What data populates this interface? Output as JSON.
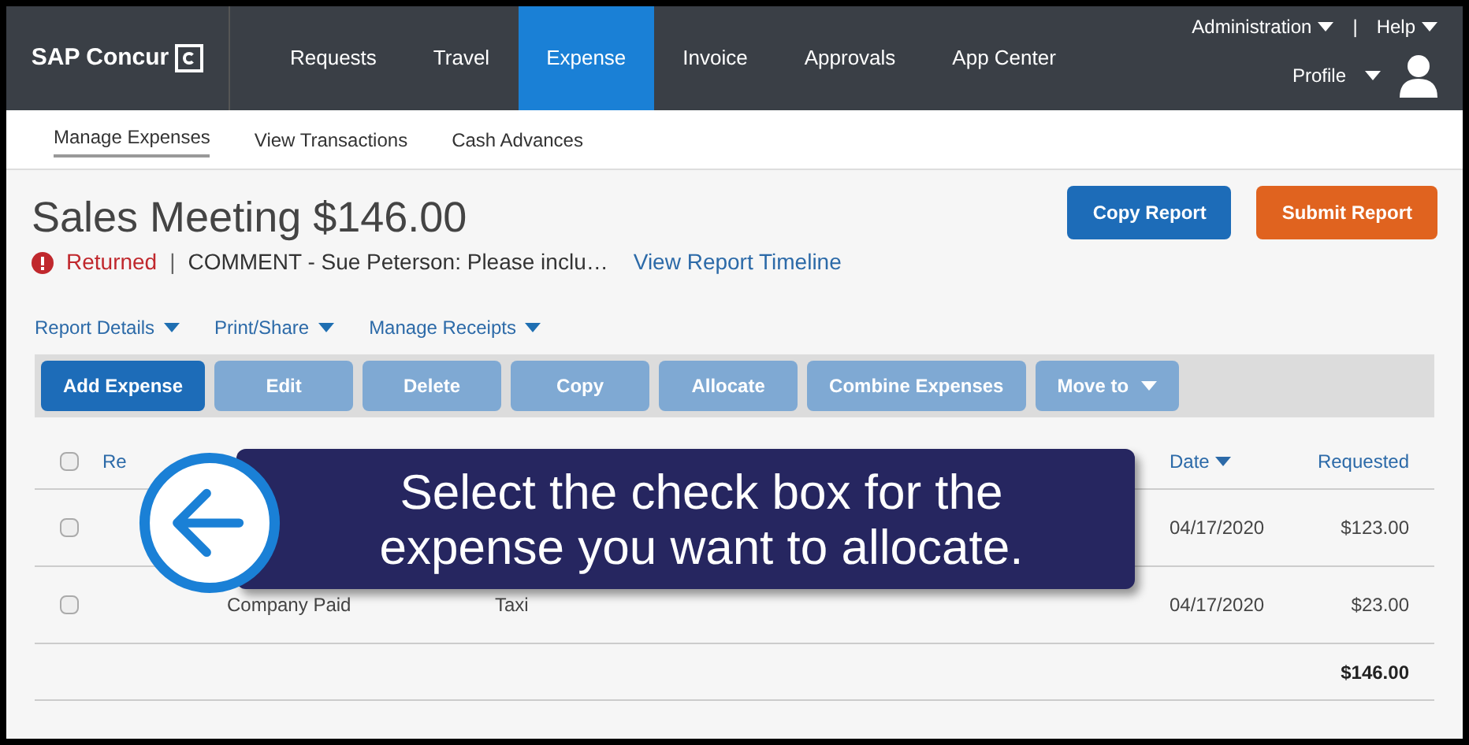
{
  "nav": {
    "logo": "SAP Concur",
    "tabs": [
      {
        "label": "Requests",
        "selected": false
      },
      {
        "label": "Travel",
        "selected": false
      },
      {
        "label": "Expense",
        "selected": true
      },
      {
        "label": "Invoice",
        "selected": false
      },
      {
        "label": "Approvals",
        "selected": false
      },
      {
        "label": "App Center",
        "selected": false
      }
    ],
    "admin": "Administration",
    "separator": "|",
    "help": "Help",
    "profile": "Profile"
  },
  "subnav": [
    {
      "label": "Manage Expenses",
      "selected": true
    },
    {
      "label": "View Transactions",
      "selected": false
    },
    {
      "label": "Cash Advances",
      "selected": false
    }
  ],
  "report": {
    "title": "Sales Meeting $146.00",
    "status": "Returned",
    "separator": "|",
    "comment": "COMMENT - Sue Peterson: Please inclu…",
    "timeline_link": "View Report Timeline",
    "copy_button": "Copy Report",
    "submit_button": "Submit Report"
  },
  "menus": [
    "Report Details",
    "Print/Share",
    "Manage Receipts"
  ],
  "toolbar": [
    {
      "label": "Add Expense",
      "disabled": false,
      "dropdown": false
    },
    {
      "label": "Edit",
      "disabled": true,
      "dropdown": false
    },
    {
      "label": "Delete",
      "disabled": true,
      "dropdown": false
    },
    {
      "label": "Copy",
      "disabled": true,
      "dropdown": false
    },
    {
      "label": "Allocate",
      "disabled": true,
      "dropdown": false
    },
    {
      "label": "Combine Expenses",
      "disabled": true,
      "dropdown": false
    },
    {
      "label": "Move to",
      "disabled": true,
      "dropdown": true
    }
  ],
  "table": {
    "header_checked": false,
    "columns": {
      "column_1": "Re",
      "date": "Date",
      "requested": "Requested"
    },
    "rows": [
      {
        "checked": false,
        "date": "04/17/2020",
        "amount": "$123.00"
      },
      {
        "checked": false,
        "payment": "Company Paid",
        "type": "Taxi",
        "date": "04/17/2020",
        "amount": "$23.00"
      }
    ],
    "total": "$146.00"
  },
  "callout": {
    "text": "Select the check box for the expense you want to allocate."
  }
}
